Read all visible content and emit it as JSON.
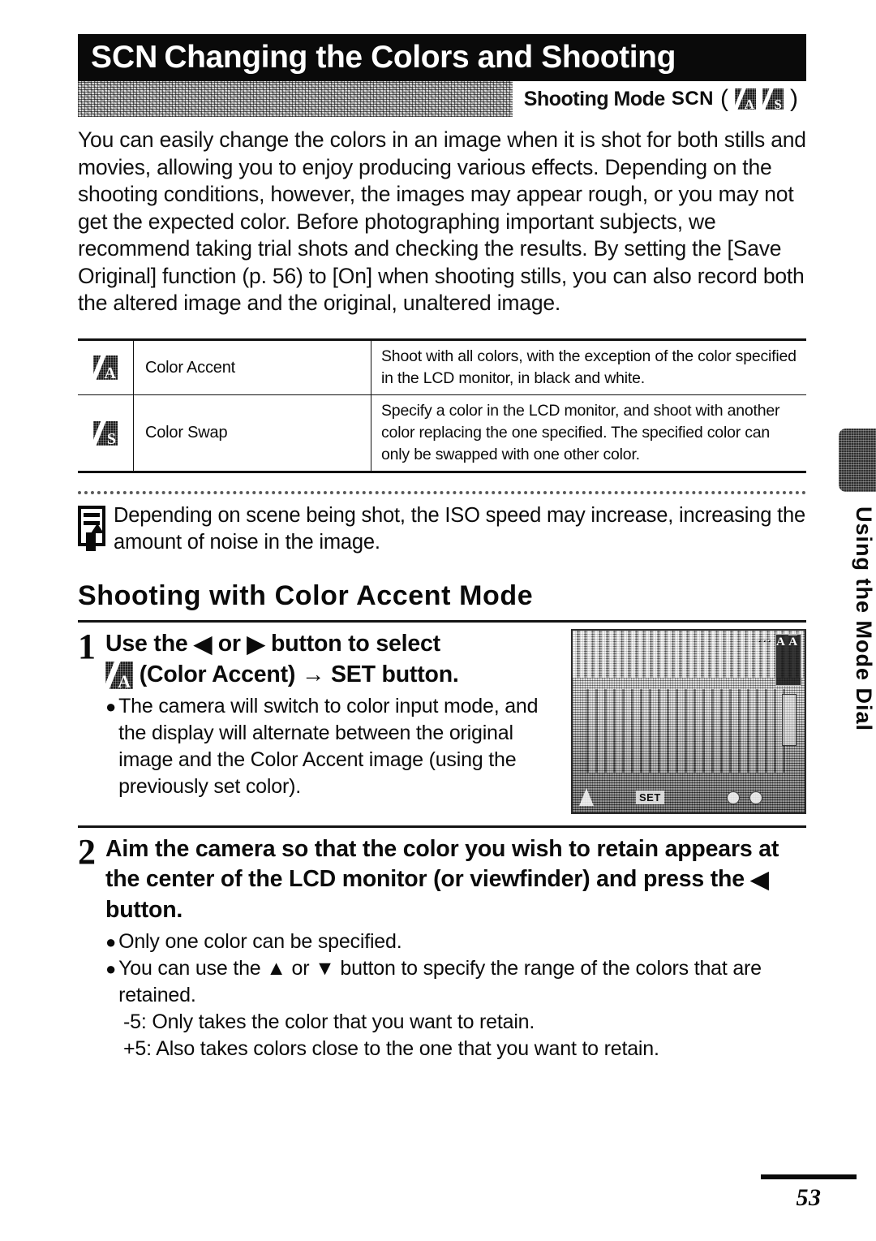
{
  "header": {
    "scn_label": "SCN",
    "title": "Changing the Colors and Shooting",
    "shooting_mode_label": "Shooting Mode",
    "shooting_mode_prefix": "SCN",
    "open_paren": "(",
    "close_paren": ")",
    "icon_accent_glyph": "A",
    "icon_swap_glyph": "S"
  },
  "intro": {
    "paragraph": "You can easily change the colors in an image when it is shot for both stills and movies, allowing you to enjoy producing various effects. Depending on the shooting conditions, however, the images may appear rough, or you may not get the expected color. Before photographing important subjects, we recommend taking trial shots and checking the results. By setting the [Save Original] function (p. 56) to [On] when shooting stills, you can also record both the altered image and the original, unaltered image."
  },
  "mode_table": {
    "rows": [
      {
        "icon_glyph": "A",
        "name": "Color Accent",
        "description": "Shoot with all colors, with the exception of the color specified in the LCD monitor, in black and white."
      },
      {
        "icon_glyph": "S",
        "name": "Color Swap",
        "description": "Specify a color in the LCD monitor, and shoot with another color replacing the one specified. The specified color can only be swapped with one other color."
      }
    ]
  },
  "note": {
    "text": "Depending on scene being shot, the ISO speed may increase, increasing the amount of noise in the image."
  },
  "section": {
    "title": "Shooting with Color Accent Mode"
  },
  "steps": [
    {
      "number": "1",
      "heading_part1": "Use the",
      "arrow_left": "◀",
      "heading_or": "or",
      "arrow_right": "▶",
      "heading_part2": "button to select",
      "heading_line2_icon_glyph": "A",
      "heading_line2_label": "(Color Accent)",
      "heading_line2_arrow": "→",
      "heading_line2_set": "SET",
      "heading_line2_tail": "button.",
      "bullets": [
        "The camera will switch to color input mode, and the display will alternate between the original image and the Color Accent image (using the previously set color)."
      ]
    },
    {
      "number": "2",
      "heading_part1": "Aim the camera so that the color you wish to retain appears at the center of the LCD monitor (or viewfinder) and press the",
      "arrow_left": "◀",
      "heading_part2": "button.",
      "bullets": [
        "Only one color can be specified.",
        "You can use the ▲ or ▼ button to specify the range of the colors that are retained."
      ],
      "sub_lines": [
        "-5: Only takes the color that you want to retain.",
        "+5: Also takes colors close to the one that you want to retain."
      ]
    }
  ],
  "lcd_preview": {
    "osd_set_label": "SET",
    "osd_top_label": "···",
    "icon_top_glyph": "A",
    "icon_bottom_glyph": "A"
  },
  "side_tab": {
    "label": "Using the Mode Dial"
  },
  "footer": {
    "page_number": "53"
  }
}
